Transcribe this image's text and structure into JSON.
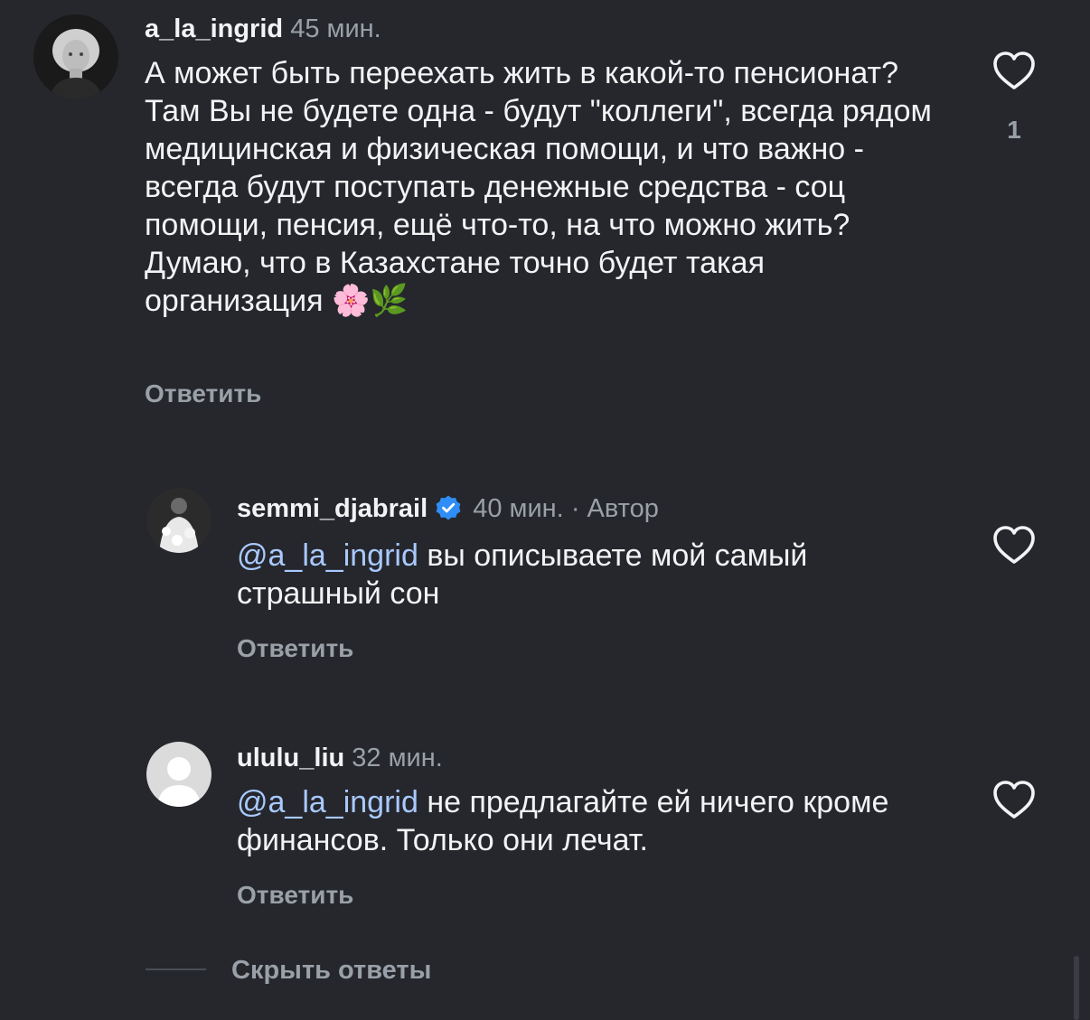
{
  "colors": {
    "background": "#25272c",
    "text": "#f2f3f5",
    "muted": "#9aa0a8",
    "mention": "#a9c9ff",
    "verified": "#2f8df7"
  },
  "comments": [
    {
      "username": "a_la_ingrid",
      "time": "45 мин.",
      "text": "А может быть переехать жить в какой-то пенсионат? Там Вы не будете одна - будут \"коллеги\", всегда рядом медицинская и физическая помощи, и что важно - всегда будут поступать денежные средства - соц помощи, пенсия, ещё что-то, на что можно жить? Думаю, что в Казахстане точно будет такая организация 🌸🌿",
      "reply": "Ответить",
      "like_icon": "heart-outline-icon",
      "like_count": "1"
    },
    {
      "username": "semmi_djabrail",
      "verified_icon": "verified-badge-icon",
      "time": "40 мин.",
      "author_tag": "· Автор",
      "mention": "@a_la_ingrid",
      "text": "вы описываете мой самый страшный сон",
      "reply": "Ответить",
      "like_icon": "heart-outline-icon"
    },
    {
      "username": "ululu_liu",
      "time": "32 мин.",
      "mention": "@a_la_ingrid",
      "text": "не предлагайте ей ничего кроме финансов. Только они лечат.",
      "reply": "Ответить",
      "like_icon": "heart-outline-icon"
    }
  ],
  "hide_replies": "Скрыть ответы"
}
